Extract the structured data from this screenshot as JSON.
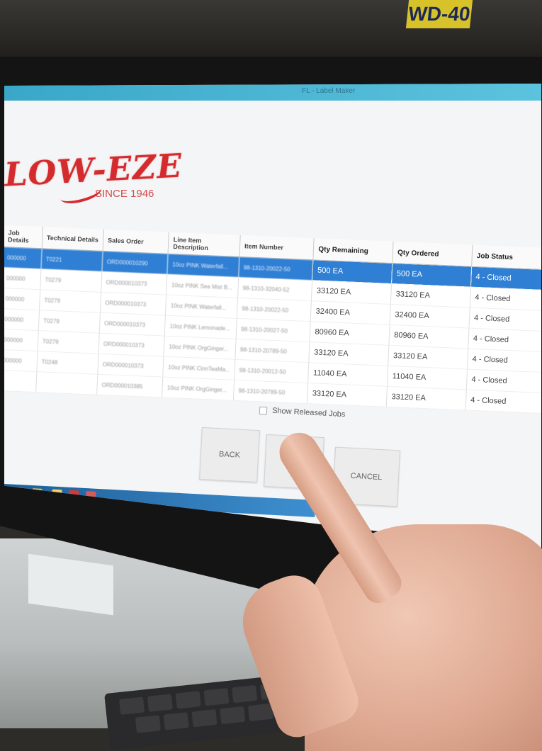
{
  "window": {
    "title": "FL - Label Maker"
  },
  "logo": {
    "brand": "LOW-EZE",
    "since": "SINCE 1946"
  },
  "table": {
    "columns": [
      "Job Details",
      "Technical Details",
      "Sales Order",
      "Line Item Description",
      "Item Number",
      "Qty Remaining",
      "Qty Ordered",
      "Job Status"
    ],
    "rows": [
      {
        "c1": "000000",
        "c2": "T0221",
        "c3": "ORD000010290",
        "c4": "10oz PINK Waterfall...",
        "item": "98-1310-20022-50",
        "qty_remaining": "500 EA",
        "qty_ordered": "500 EA",
        "status": "4 - Closed",
        "selected": true
      },
      {
        "c1": "000000",
        "c2": "T0279",
        "c3": "ORD000010373",
        "c4": "10oz PINK Sea Mist B...",
        "item": "98-1310-32040-52",
        "qty_remaining": "33120 EA",
        "qty_ordered": "33120 EA",
        "status": "4 - Closed",
        "selected": false
      },
      {
        "c1": "000000",
        "c2": "T0279",
        "c3": "ORD000010373",
        "c4": "10oz PINK Waterfall...",
        "item": "98-1310-20022-50",
        "qty_remaining": "32400 EA",
        "qty_ordered": "32400 EA",
        "status": "4 - Closed",
        "selected": false
      },
      {
        "c1": "000000",
        "c2": "T0279",
        "c3": "ORD000010373",
        "c4": "10oz PINK Lemonade...",
        "item": "98-1310-20027-50",
        "qty_remaining": "80960 EA",
        "qty_ordered": "80960 EA",
        "status": "4 - Closed",
        "selected": false
      },
      {
        "c1": "000000",
        "c2": "T0279",
        "c3": "ORD000010373",
        "c4": "10oz PINK OrgGinger...",
        "item": "98-1310-20789-50",
        "qty_remaining": "33120 EA",
        "qty_ordered": "33120 EA",
        "status": "4 - Closed",
        "selected": false
      },
      {
        "c1": "000000",
        "c2": "T0248",
        "c3": "ORD000010373",
        "c4": "10oz PINK CinnTeaMa...",
        "item": "98-1310-20012-50",
        "qty_remaining": "11040 EA",
        "qty_ordered": "11040 EA",
        "status": "4 - Closed",
        "selected": false
      },
      {
        "c1": "",
        "c2": "",
        "c3": "ORD000010385",
        "c4": "10oz PINK OrgGinger...",
        "item": "98-1310-20789-50",
        "qty_remaining": "33120 EA",
        "qty_ordered": "33120 EA",
        "status": "4 - Closed",
        "selected": false
      }
    ]
  },
  "controls": {
    "show_released_label": "Show Released Jobs",
    "back_label": "BACK",
    "middle_label": "",
    "cancel_label": "CANCEL"
  },
  "scene": {
    "sign_text": "WD-40"
  },
  "colors": {
    "titlebar": "#3aa7c9",
    "selected_row": "#2f7fd4",
    "logo_red": "#d42b2e"
  }
}
